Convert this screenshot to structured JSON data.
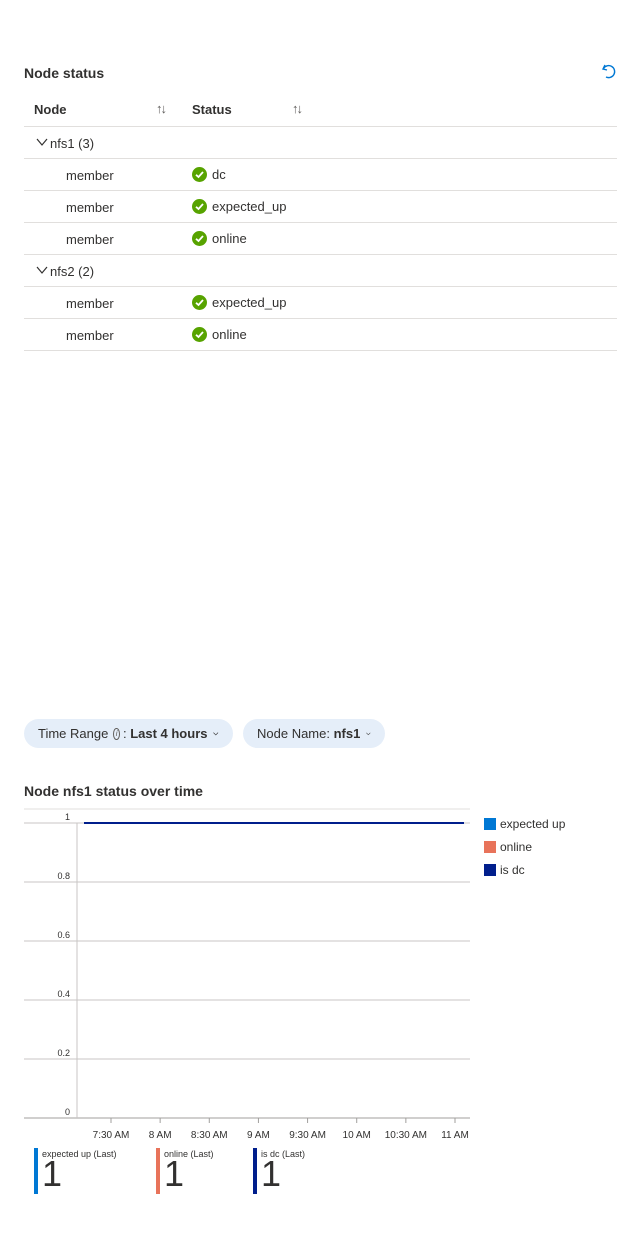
{
  "node_status": {
    "title": "Node status",
    "refresh_icon": "refresh-icon",
    "columns": {
      "node": "Node",
      "status": "Status",
      "sort_glyph": "↑↓"
    },
    "groups": [
      {
        "label": "nfs1 (3)",
        "rows": [
          {
            "node": "member",
            "status": "dc"
          },
          {
            "node": "member",
            "status": "expected_up"
          },
          {
            "node": "member",
            "status": "online"
          }
        ]
      },
      {
        "label": "nfs2 (2)",
        "rows": [
          {
            "node": "member",
            "status": "expected_up"
          },
          {
            "node": "member",
            "status": "online"
          }
        ]
      }
    ],
    "status_color": "#57a300"
  },
  "filters": {
    "time_range": {
      "label": "Time Range",
      "separator": ":",
      "value": "Last 4 hours"
    },
    "node_name": {
      "label": "Node Name:",
      "value": "nfs1"
    }
  },
  "chart_title": "Node nfs1 status over time",
  "chart_data": {
    "type": "line",
    "title": "Node nfs1 status over time",
    "x": [
      "7:30 AM",
      "8 AM",
      "8:30 AM",
      "9 AM",
      "9:30 AM",
      "10 AM",
      "10:30 AM",
      "11 AM"
    ],
    "ylim": [
      0,
      1
    ],
    "y_ticks": [
      "0",
      "0.2",
      "0.4",
      "0.6",
      "0.8",
      "1"
    ],
    "grid": true,
    "legend_position": "right",
    "series": [
      {
        "name": "expected up",
        "color": "#0078d4",
        "values": [
          1,
          1,
          1,
          1,
          1,
          1,
          1,
          1
        ]
      },
      {
        "name": "online",
        "color": "#e8735a",
        "values": [
          1,
          1,
          1,
          1,
          1,
          1,
          1,
          1
        ]
      },
      {
        "name": "is dc",
        "color": "#001e8c",
        "values": [
          1,
          1,
          1,
          1,
          1,
          1,
          1,
          1
        ]
      }
    ]
  },
  "tiles": [
    {
      "label": "expected up (Last)",
      "value": "1",
      "color": "#0078d4"
    },
    {
      "label": "online (Last)",
      "value": "1",
      "color": "#e8735a"
    },
    {
      "label": "is dc (Last)",
      "value": "1",
      "color": "#001e8c"
    }
  ]
}
